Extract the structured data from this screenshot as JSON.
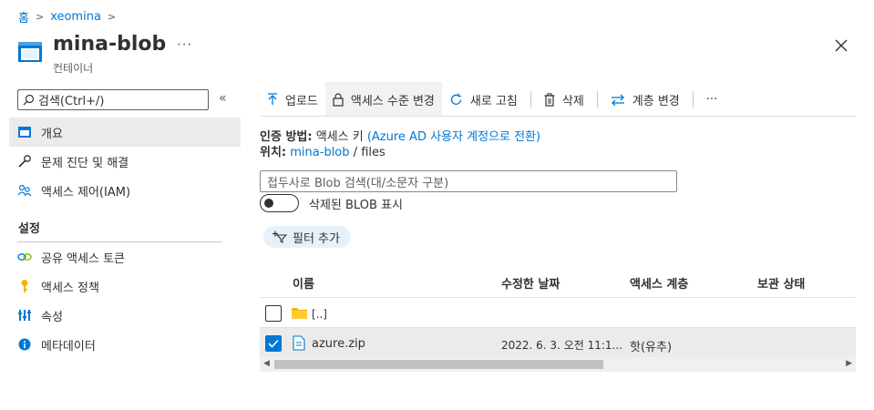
{
  "breadcrumb": {
    "home": "홈",
    "account": "xeomina"
  },
  "header": {
    "title": "mina-blob",
    "subtitle": "컨테이너",
    "more": "···"
  },
  "nav": {
    "search_placeholder": "검색(Ctrl+/)",
    "collapse": "«",
    "items": [
      {
        "label": "개요",
        "icon": "overview-icon"
      },
      {
        "label": "문제 진단 및 해결",
        "icon": "wrench-icon"
      },
      {
        "label": "액세스 제어(IAM)",
        "icon": "people-icon"
      }
    ],
    "section_settings": "설정",
    "settings_items": [
      {
        "label": "공유 액세스 토큰",
        "icon": "link-icon"
      },
      {
        "label": "액세스 정책",
        "icon": "key-icon"
      },
      {
        "label": "속성",
        "icon": "properties-icon"
      },
      {
        "label": "메타데이터",
        "icon": "info-icon"
      }
    ]
  },
  "toolbar": {
    "upload": "업로드",
    "access_level": "액세스 수준 변경",
    "refresh": "새로 고침",
    "delete": "삭제",
    "tier": "계층 변경",
    "more": "···"
  },
  "info": {
    "auth_label": "인증 방법:",
    "auth_value": "액세스 키",
    "auth_link": "(Azure AD 사용자 계정으로 전환)",
    "location_label": "위치:",
    "location_link": "mina-blob",
    "location_sep": "/",
    "location_path": "files"
  },
  "blob_search_placeholder": "접두사로 Blob 검색(대/소문자 구분)",
  "toggle_label": "삭제된 BLOB 표시",
  "filter_label": "필터 추가",
  "table": {
    "headers": [
      "이름",
      "수정한 날짜",
      "액세스 계층",
      "보관 상태"
    ],
    "rows": [
      {
        "name": "[..]",
        "modified": "",
        "tier": "",
        "checked": false,
        "type": "folder"
      },
      {
        "name": "azure.zip",
        "modified": "2022. 6. 3. 오전 11:1...",
        "tier": "핫(유추)",
        "checked": true,
        "type": "file"
      }
    ]
  },
  "colors": {
    "accent": "#0078d4",
    "selected_row": "#edebe9"
  }
}
